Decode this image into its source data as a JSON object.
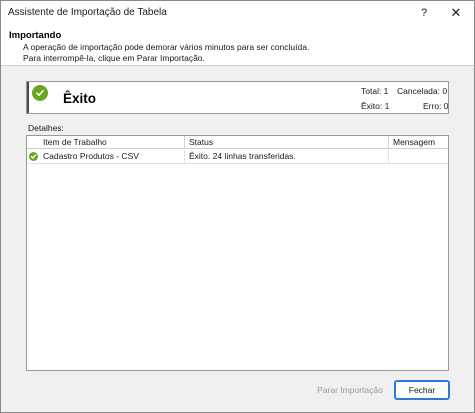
{
  "window": {
    "title": "Assistente de Importação de Tabela",
    "help_glyph": "?",
    "close_glyph": "✕"
  },
  "header": {
    "title": "Importando",
    "description": "A operação de importação pode demorar vários minutos para ser concluída. Para interrompê-la, clique em Parar Importação."
  },
  "status": {
    "title": "Êxito",
    "icon": "success-check-icon",
    "total": "Total: 1",
    "cancelled": "Cancelada: 0",
    "success": "Êxito: 1",
    "error": "Erro: 0",
    "success_color": "#6aa61e"
  },
  "details": {
    "label": "Detalhes:",
    "columns": [
      "Item de Trabalho",
      "Status",
      "Mensagem"
    ],
    "rows": [
      {
        "item": "Cadastro Produtos - CSV",
        "status": "Êxito. 24 linhas transferidas.",
        "message": ""
      }
    ]
  },
  "buttons": {
    "stop": "Parar Importação",
    "close": "Fechar"
  }
}
